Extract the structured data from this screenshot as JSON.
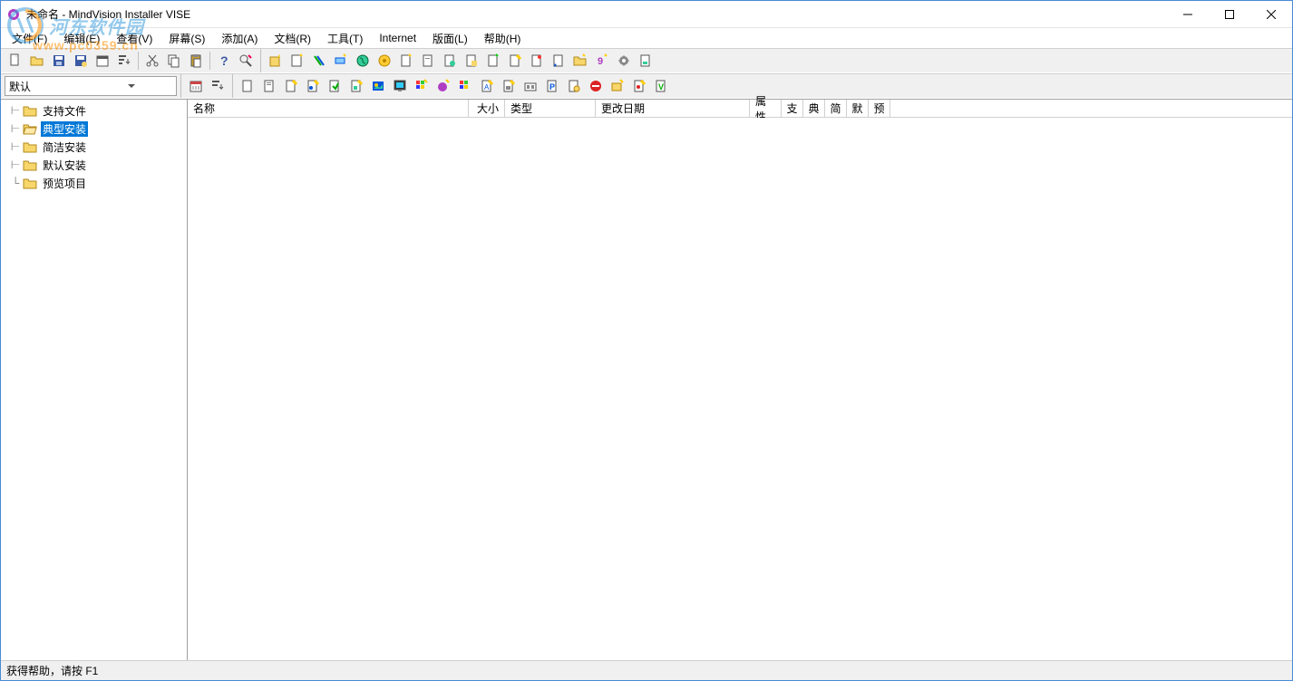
{
  "titlebar": {
    "title": "未命名 - MindVision Installer VISE"
  },
  "menubar": {
    "items": [
      "文件(F)",
      "编辑(E)",
      "查看(V)",
      "屏幕(S)",
      "添加(A)",
      "文档(R)",
      "工具(T)",
      "Internet",
      "版面(L)",
      "帮助(H)"
    ]
  },
  "toolbar1": {
    "icons": [
      "new-file",
      "open-folder",
      "save-disk",
      "save-as",
      "date-picker",
      "move-down",
      "sep",
      "cut",
      "copy",
      "paste",
      "sep",
      "help",
      "find"
    ]
  },
  "toolbar1b": {
    "icons": [
      "wiz-yellow",
      "wiz-folder",
      "wiz-slash",
      "wiz-right",
      "wiz-globe-1",
      "wiz-globe-2",
      "wiz-doc-1",
      "wiz-doc-2",
      "wiz-doc-3",
      "wiz-doc-4",
      "wiz-doc-5",
      "wiz-doc-star",
      "wiz-doc-6",
      "wiz-doc-7",
      "wiz-folder-2",
      "wiz-9",
      "wiz-gear",
      "wiz-doc-8"
    ]
  },
  "dropdown": {
    "value": "默认"
  },
  "toolbar2a": {
    "icons": [
      "calendar",
      "list-down"
    ]
  },
  "toolbar2b": {
    "icons": [
      "pg-1",
      "pg-2",
      "pg-star-1",
      "pg-star-2",
      "pg-arrow",
      "pg-star-3",
      "pg-img",
      "pg-scr",
      "pg-pal",
      "pg-star-4",
      "pg-pal2",
      "pg-star-5",
      "pg-star-6",
      "pg-box",
      "pg-p",
      "pg-doc",
      "pg-red",
      "pg-star-7",
      "pg-star-8",
      "pg-v"
    ]
  },
  "tree": {
    "items": [
      {
        "label": "支持文件",
        "selected": false
      },
      {
        "label": "典型安装",
        "selected": true
      },
      {
        "label": "简洁安装",
        "selected": false
      },
      {
        "label": "默认安装",
        "selected": false
      },
      {
        "label": "预览项目",
        "selected": false
      }
    ]
  },
  "columns": {
    "name": "名称",
    "size": "大小",
    "type": "类型",
    "modified": "更改日期",
    "attr": "属性",
    "c1": "支",
    "c2": "典",
    "c3": "简",
    "c4": "默",
    "c5": "预"
  },
  "statusbar": {
    "text": "获得帮助，请按 F1"
  },
  "watermark": {
    "text": "河东软件园",
    "url": "www.pc0359.cn"
  }
}
